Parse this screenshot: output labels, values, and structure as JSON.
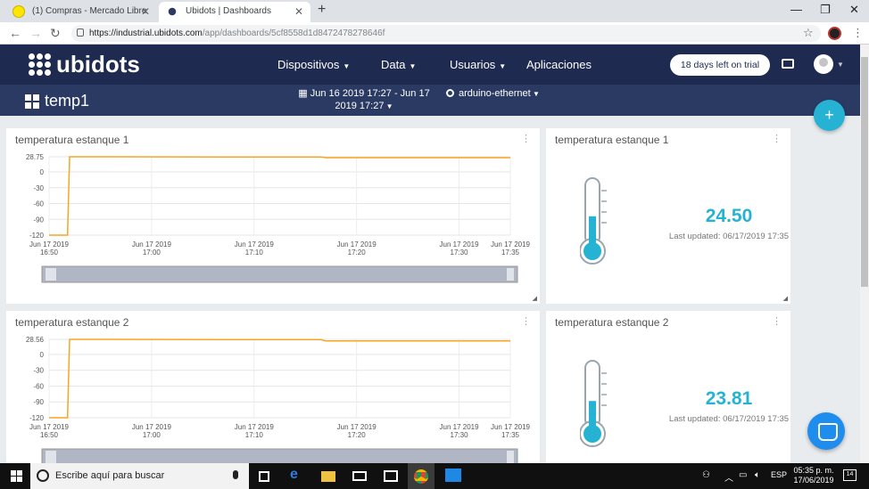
{
  "browser": {
    "tabs": [
      {
        "title": "(1) Compras - Mercado Libre",
        "active": false
      },
      {
        "title": "Ubidots | Dashboards",
        "active": true
      }
    ],
    "url_host": "https://industrial.ubidots.com",
    "url_path": "/app/dashboards/5cf8558d1d8472478278646f"
  },
  "header": {
    "logo": "ubidots",
    "menu": [
      "Dispositivos",
      "Data",
      "Usuarios",
      "Aplicaciones"
    ],
    "trial_label": "18 days left on trial"
  },
  "subheader": {
    "dashboard_name": "temp1",
    "date_range_line1": "Jun 16 2019 17:27 - Jun 17",
    "date_range_line2": "2019 17:27",
    "device": "arduino-ethernet"
  },
  "widgets": {
    "chart1": {
      "title": "temperatura estanque 1"
    },
    "chart2": {
      "title": "temperatura estanque 2"
    },
    "therm1": {
      "title": "temperatura estanque 1",
      "value": "24.50",
      "updated": "Last updated: 06/17/2019 17:35"
    },
    "therm2": {
      "title": "temperatura estanque 2",
      "value": "23.81",
      "updated": "Last updated: 06/17/2019 17:35"
    }
  },
  "chart_data": [
    {
      "type": "line",
      "title": "temperatura estanque 1",
      "y_ticks": [
        "28.75",
        "0",
        "-30",
        "-60",
        "-90",
        "-120"
      ],
      "y_tick_values": [
        28.75,
        0,
        -30,
        -60,
        -90,
        -120
      ],
      "ylim": [
        -120,
        28.75
      ],
      "x_tick_labels": [
        [
          "Jun 17 2019",
          "16:50"
        ],
        [
          "Jun 17 2019",
          "17:00"
        ],
        [
          "Jun 17 2019",
          "17:10"
        ],
        [
          "Jun 17 2019",
          "17:20"
        ],
        [
          "Jun 17 2019",
          "17:30"
        ],
        [
          "Jun 17 2019",
          "17:35"
        ]
      ],
      "x_tick_minutes": [
        0,
        10,
        20,
        30,
        40,
        45
      ],
      "xlim_minutes": [
        0,
        45
      ],
      "series": [
        {
          "x": [
            0,
            1.8,
            2.0,
            26.5,
            27.0,
            45
          ],
          "y": [
            -120,
            -120,
            28.75,
            28.2,
            27.0,
            27.0
          ],
          "color": "#f5a623"
        }
      ],
      "grid": true
    },
    {
      "type": "line",
      "title": "temperatura estanque 2",
      "y_ticks": [
        "28.56",
        "0",
        "-30",
        "-60",
        "-90",
        "-120"
      ],
      "y_tick_values": [
        28.56,
        0,
        -30,
        -60,
        -90,
        -120
      ],
      "ylim": [
        -120,
        28.56
      ],
      "x_tick_labels": [
        [
          "Jun 17 2019",
          "16:50"
        ],
        [
          "Jun 17 2019",
          "17:00"
        ],
        [
          "Jun 17 2019",
          "17:10"
        ],
        [
          "Jun 17 2019",
          "17:20"
        ],
        [
          "Jun 17 2019",
          "17:30"
        ],
        [
          "Jun 17 2019",
          "17:35"
        ]
      ],
      "x_tick_minutes": [
        0,
        10,
        20,
        30,
        40,
        45
      ],
      "xlim_minutes": [
        0,
        45
      ],
      "series": [
        {
          "x": [
            0,
            1.8,
            2.0,
            26.5,
            27.0,
            45
          ],
          "y": [
            -120,
            -120,
            28.56,
            28.0,
            25.5,
            25.5
          ],
          "color": "#f5a623"
        }
      ],
      "grid": true
    }
  ],
  "thermometers": [
    {
      "level": 0.42
    },
    {
      "level": 0.38
    }
  ],
  "taskbar": {
    "search_placeholder": "Escribe aquí para buscar",
    "lang": "ESP",
    "time": "05:35 p. m.",
    "date": "17/06/2019",
    "notifications": "14"
  },
  "colors": {
    "accent": "#26b3d3",
    "header": "#1e2a4f",
    "subheader": "#2b3a63",
    "series": "#f5a623"
  }
}
